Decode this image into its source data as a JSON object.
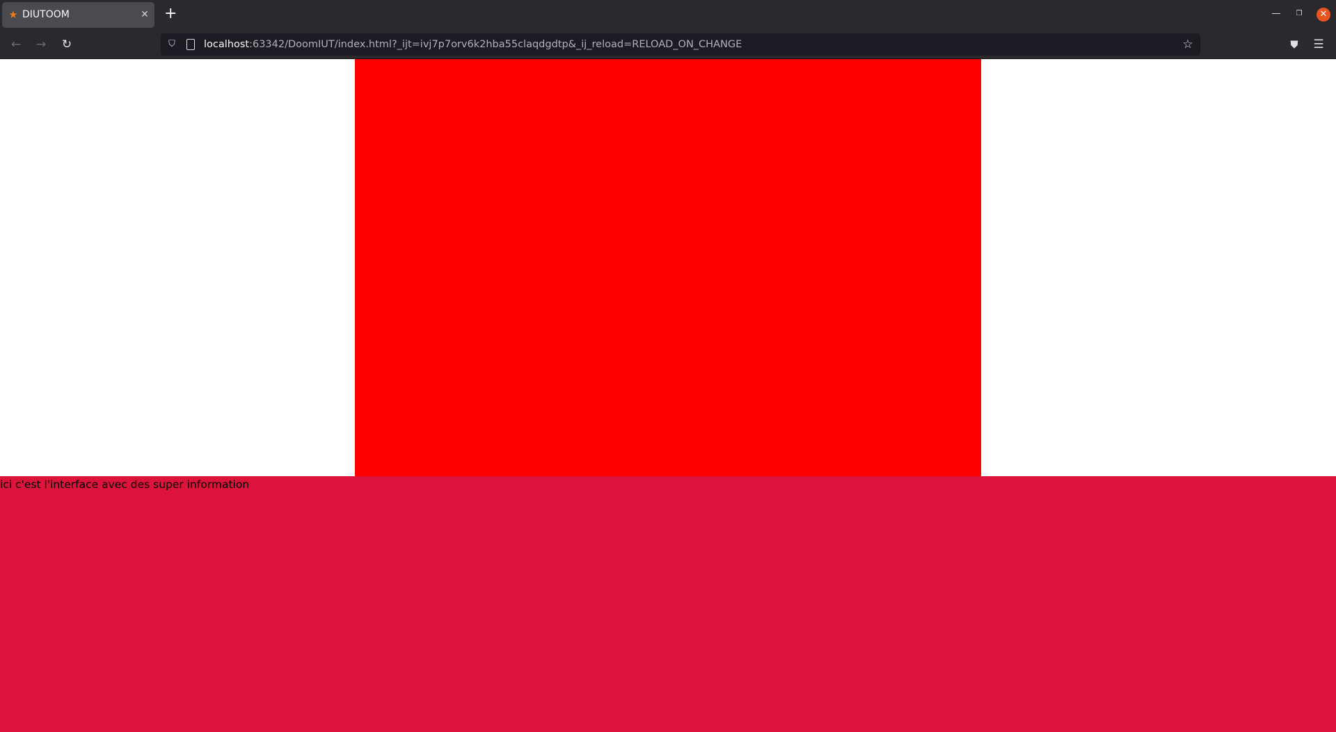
{
  "browser": {
    "tab": {
      "title": "DIUTOOM",
      "favicon": "star-icon"
    },
    "url": {
      "host": "localhost",
      "path": ":63342/DoomIUT/index.html?_ijt=ivj7p7orv6k2hba55claqdgdtp&_ij_reload=RELOAD_ON_CHANGE"
    },
    "colors": {
      "chrome": "#2a2a2e",
      "tab_active": "#4a4a4f",
      "urlbar": "#1c1b22",
      "window_close": "#e95420"
    }
  },
  "page": {
    "canvas_color": "#ff0000",
    "interface": {
      "text": "ici c'est l'interface avec des super information",
      "color": "#dc143c"
    }
  }
}
